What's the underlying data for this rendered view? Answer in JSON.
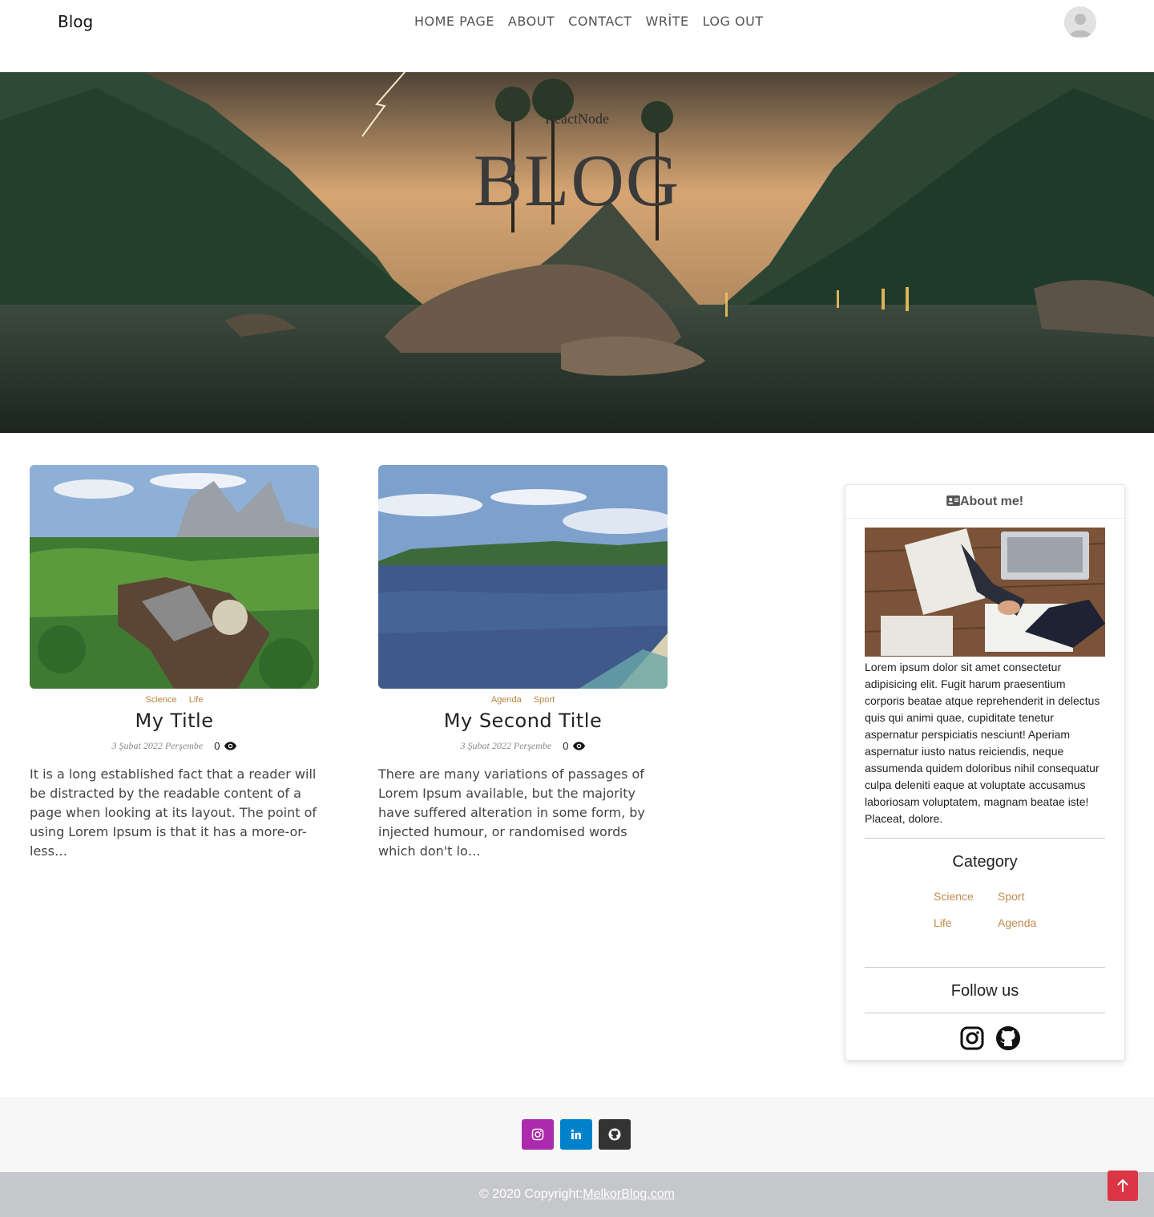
{
  "navbar": {
    "brand": "Blog",
    "links": [
      "HOME PAGE",
      "ABOUT",
      "CONTACT",
      "WRİTE",
      "LOG OUT"
    ],
    "avatar_icon": "user-avatar"
  },
  "hero": {
    "subtitle": "ReactNode",
    "title": "BLOG"
  },
  "posts": [
    {
      "categories": [
        "Science",
        "Life"
      ],
      "title": "My Title",
      "date": "3 Şubat 2022 Perşembe",
      "views": "0",
      "description": "It is a long established fact that a reader will be distracted by the readable content of a page when looking at its layout. The point of using Lorem Ipsum is that it has a more-or-less…"
    },
    {
      "categories": [
        "Agenda",
        "Sport"
      ],
      "title": "My Second Title",
      "date": "3 Şubat 2022 Perşembe",
      "views": "0",
      "description": "There are many variations of passages of Lorem Ipsum available, but the majority have suffered alteration in some form, by injected humour, or randomised words which don't lo…"
    }
  ],
  "sidebar": {
    "header": "About me!",
    "about_text": "Lorem ipsum dolor sit amet consectetur adipisicing elit. Fugit harum praesentium corporis beatae atque reprehenderit in delectus quis qui animi quae, cupiditate tenetur aspernatur perspiciatis nesciunt! Aperiam aspernatur iusto natus reiciendis, neque assumenda quidem doloribus nihil consequatur culpa deleniti eaque at voluptate accusamus laboriosam voluptatem, magnam beatae iste! Placeat, dolore.",
    "category_heading": "Category",
    "categories": [
      "Science",
      "Sport",
      "Life",
      "Agenda"
    ],
    "follow_heading": "Follow us",
    "social_icons": [
      "instagram-icon",
      "github-icon"
    ]
  },
  "footer": {
    "buttons": [
      "instagram-icon",
      "linkedin-icon",
      "github-icon"
    ],
    "copyright_prefix": "© 2020 Copyright:",
    "copyright_link": "MelkorBlog.com"
  },
  "colors": {
    "accent": "#c08a4c",
    "instagram": "#ac2bac",
    "linkedin": "#0082ca",
    "github": "#333333",
    "back_to_top": "#dc3545"
  }
}
